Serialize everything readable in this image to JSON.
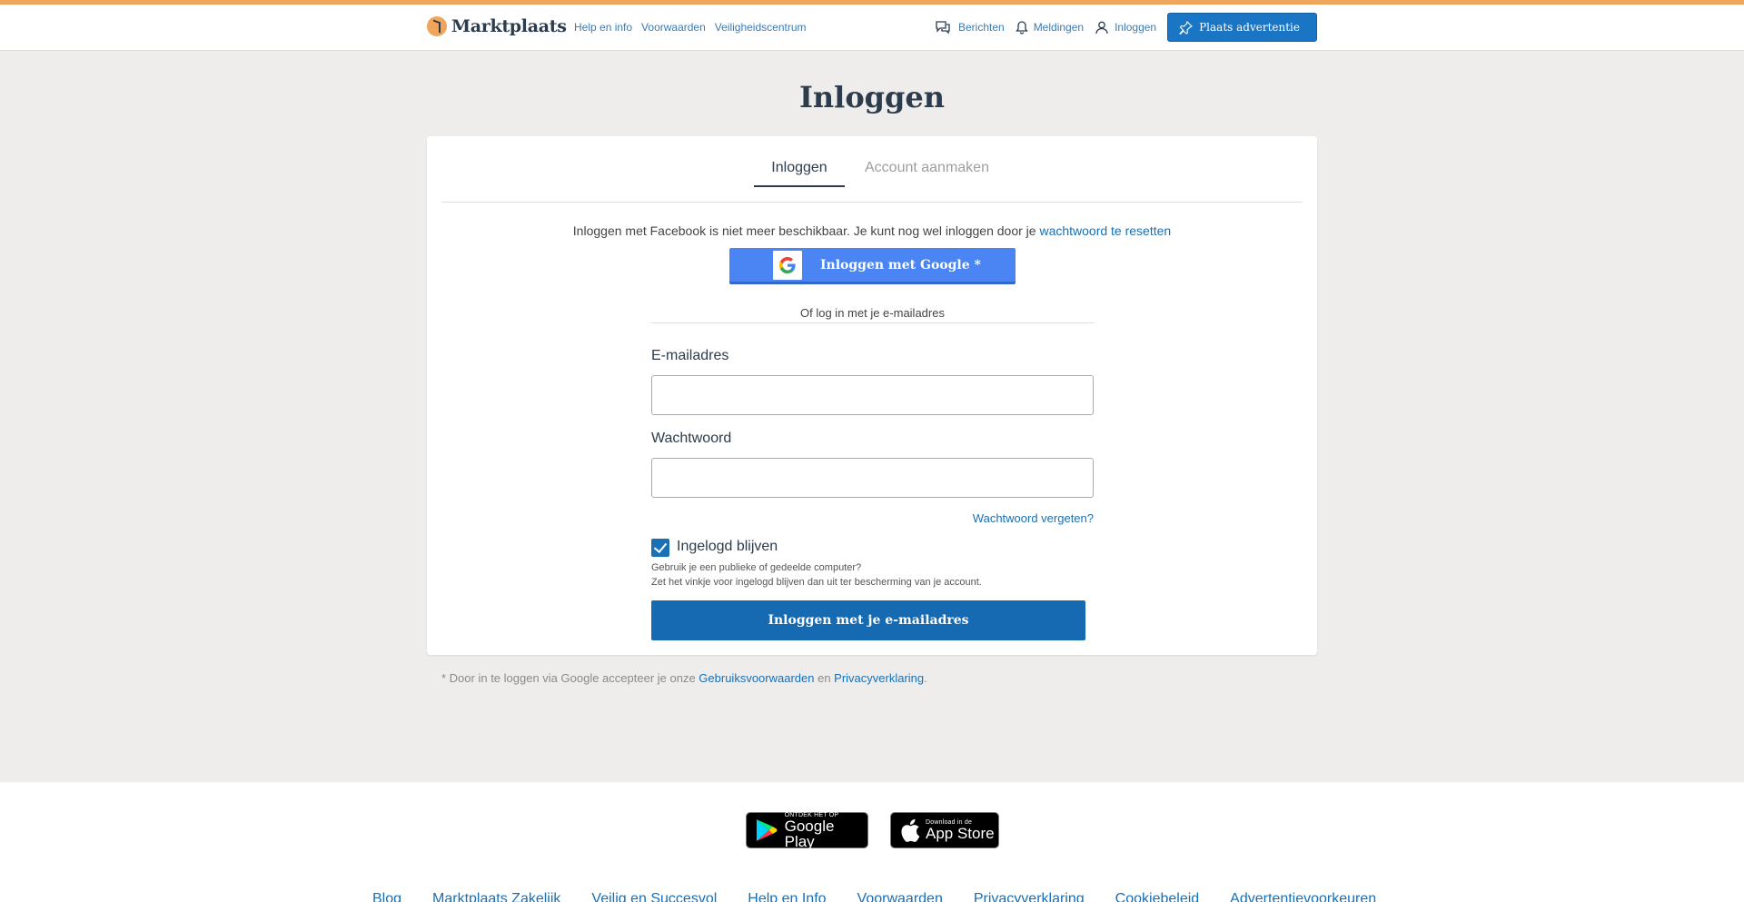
{
  "header": {
    "brand": "Marktplaats",
    "links": [
      "Help en info",
      "Voorwaarden",
      "Veiligheidscentrum"
    ],
    "nav": {
      "messages": "Berichten",
      "notifications": "Meldingen",
      "login": "Inloggen"
    },
    "place_ad": "Plaats advertentie"
  },
  "page": {
    "title": "Inloggen"
  },
  "tabs": {
    "login": "Inloggen",
    "register": "Account aanmaken"
  },
  "notice": {
    "text": "Inloggen met Facebook is niet meer beschikbaar. Je kunt nog wel inloggen door je ",
    "link": "wachtwoord te resetten"
  },
  "google": {
    "label": "Inloggen met Google *"
  },
  "divider": "Of log in met je e-mailadres",
  "form": {
    "email_label": "E-mailadres",
    "email_value": "",
    "password_label": "Wachtwoord",
    "password_value": "",
    "forgot": "Wachtwoord vergeten?",
    "remember_label": "Ingelogd blijven",
    "remember_checked": true,
    "hint_1": "Gebruik je een publieke of gedeelde computer?",
    "hint_2": "Zet het vinkje voor ingelogd blijven dan uit ter bescherming van je account.",
    "submit": "Inloggen met je e-mailadres"
  },
  "terms": {
    "prefix": "* Door in te loggen via Google accepteer je onze ",
    "link1": "Gebruiksvoorwaarden",
    "mid": " en ",
    "link2": "Privacyverklaring",
    "suffix": "."
  },
  "footer": {
    "google_play_small": "ONTDEK HET OP",
    "google_play_big": "Google Play",
    "app_store_small": "Download in de",
    "app_store_big": "App Store",
    "links": [
      "Blog",
      "Marktplaats Zakelijk",
      "Veilig en Succesvol",
      "Help en Info",
      "Voorwaarden",
      "Privacyverklaring",
      "Cookiebeleid",
      "Advertentievoorkeuren"
    ]
  },
  "colors": {
    "accent": "#f0a55c",
    "primary": "#1a6fb5",
    "google": "#4a85f3"
  }
}
